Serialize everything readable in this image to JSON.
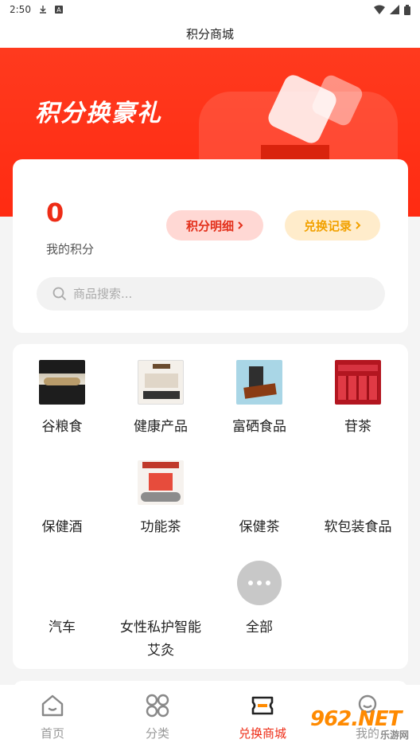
{
  "status_bar": {
    "time": "2:50"
  },
  "header": {
    "title": "积分商城"
  },
  "banner": {
    "title": "积分换豪礼"
  },
  "points": {
    "value": "0",
    "label": "我的积分",
    "detail_button": "积分明细",
    "record_button": "兑换记录",
    "search_placeholder": "商品搜索..."
  },
  "categories": [
    {
      "label": "谷粮食"
    },
    {
      "label": "健康产品"
    },
    {
      "label": "富硒食品"
    },
    {
      "label": "苷茶"
    },
    {
      "label": "保健酒"
    },
    {
      "label": "功能茶"
    },
    {
      "label": "保健茶"
    },
    {
      "label": "软包装食品"
    },
    {
      "label": "汽车"
    },
    {
      "label": "女性私护智能艾灸"
    },
    {
      "label": "全部"
    }
  ],
  "tabs": [
    {
      "label": "首页",
      "icon": "home-icon"
    },
    {
      "label": "分类",
      "icon": "grid-icon"
    },
    {
      "label": "兑换商城",
      "icon": "exchange-icon"
    },
    {
      "label": "我的",
      "icon": "user-icon"
    }
  ],
  "watermark": {
    "main": "962.NET",
    "sub": "乐游网"
  },
  "colors": {
    "brand": "#ff2b12",
    "accent_orange": "#f2a100"
  }
}
